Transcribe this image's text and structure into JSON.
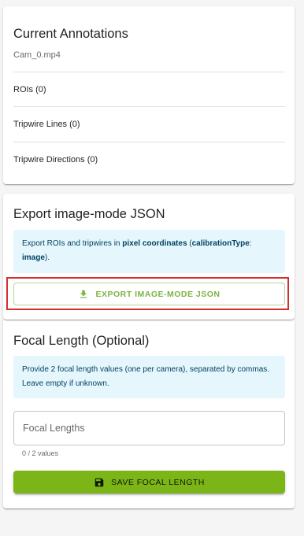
{
  "annotations": {
    "title": "Current Annotations",
    "file_name": "Cam_0.mp4",
    "rows": [
      {
        "label": "ROIs (0)"
      },
      {
        "label": "Tripwire Lines (0)"
      },
      {
        "label": "Tripwire Directions (0)"
      }
    ]
  },
  "export": {
    "title": "Export image-mode JSON",
    "info_prefix": "Export ROIs and tripwires in ",
    "info_bold_1": "pixel coordinates",
    "info_mid": " (",
    "info_bold_2": "calibrationType",
    "info_colon": ": ",
    "info_bold_3": "image",
    "info_suffix": ").",
    "button_label": "EXPORT IMAGE-MODE JSON",
    "button_icon": "download-icon"
  },
  "focal": {
    "title": "Focal Length (Optional)",
    "info": "Provide 2 focal length values (one per camera), separated by commas. Leave empty if unknown.",
    "input_value": "",
    "input_placeholder": "Focal Lengths",
    "helper": "0 / 2 values",
    "save_label": "SAVE FOCAL LENGTH",
    "save_icon": "save-icon"
  },
  "colors": {
    "accent": "#7cb342",
    "save_button_bg": "#7cb518",
    "info_bg": "#e5f6fd",
    "highlight_border": "#d32f2f"
  }
}
